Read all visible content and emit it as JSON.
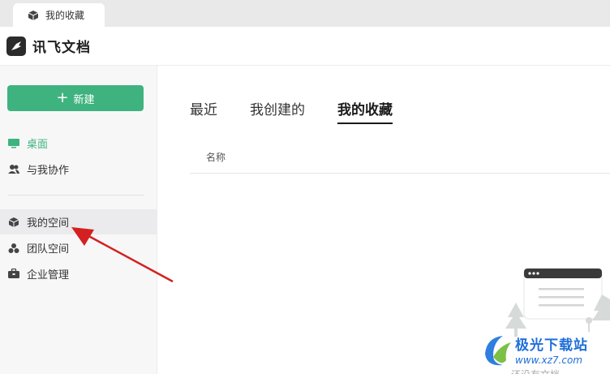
{
  "window_tab": {
    "label": "我的收藏",
    "icon": "cube-icon"
  },
  "header": {
    "app_title": "讯飞文档",
    "logo": "bird-logo-icon"
  },
  "sidebar": {
    "new_button_label": "新建",
    "items": [
      {
        "label": "桌面",
        "icon": "desktop-icon",
        "active": true
      },
      {
        "label": "与我协作",
        "icon": "users-icon"
      },
      {
        "label": "我的空间",
        "icon": "cube-icon"
      },
      {
        "label": "团队空间",
        "icon": "team-icon"
      },
      {
        "label": "企业管理",
        "icon": "briefcase-icon"
      }
    ]
  },
  "main": {
    "tabs": [
      {
        "label": "最近"
      },
      {
        "label": "我创建的"
      },
      {
        "label": "我的收藏",
        "active": true
      }
    ],
    "column_header": "名称",
    "empty_text": "还没有文档"
  },
  "watermark": {
    "name": "极光下载站",
    "url": "www.xz7.com"
  },
  "colors": {
    "accent": "#3fb37f",
    "arrow": "#d42020",
    "watermark": "#1e6fd9"
  }
}
